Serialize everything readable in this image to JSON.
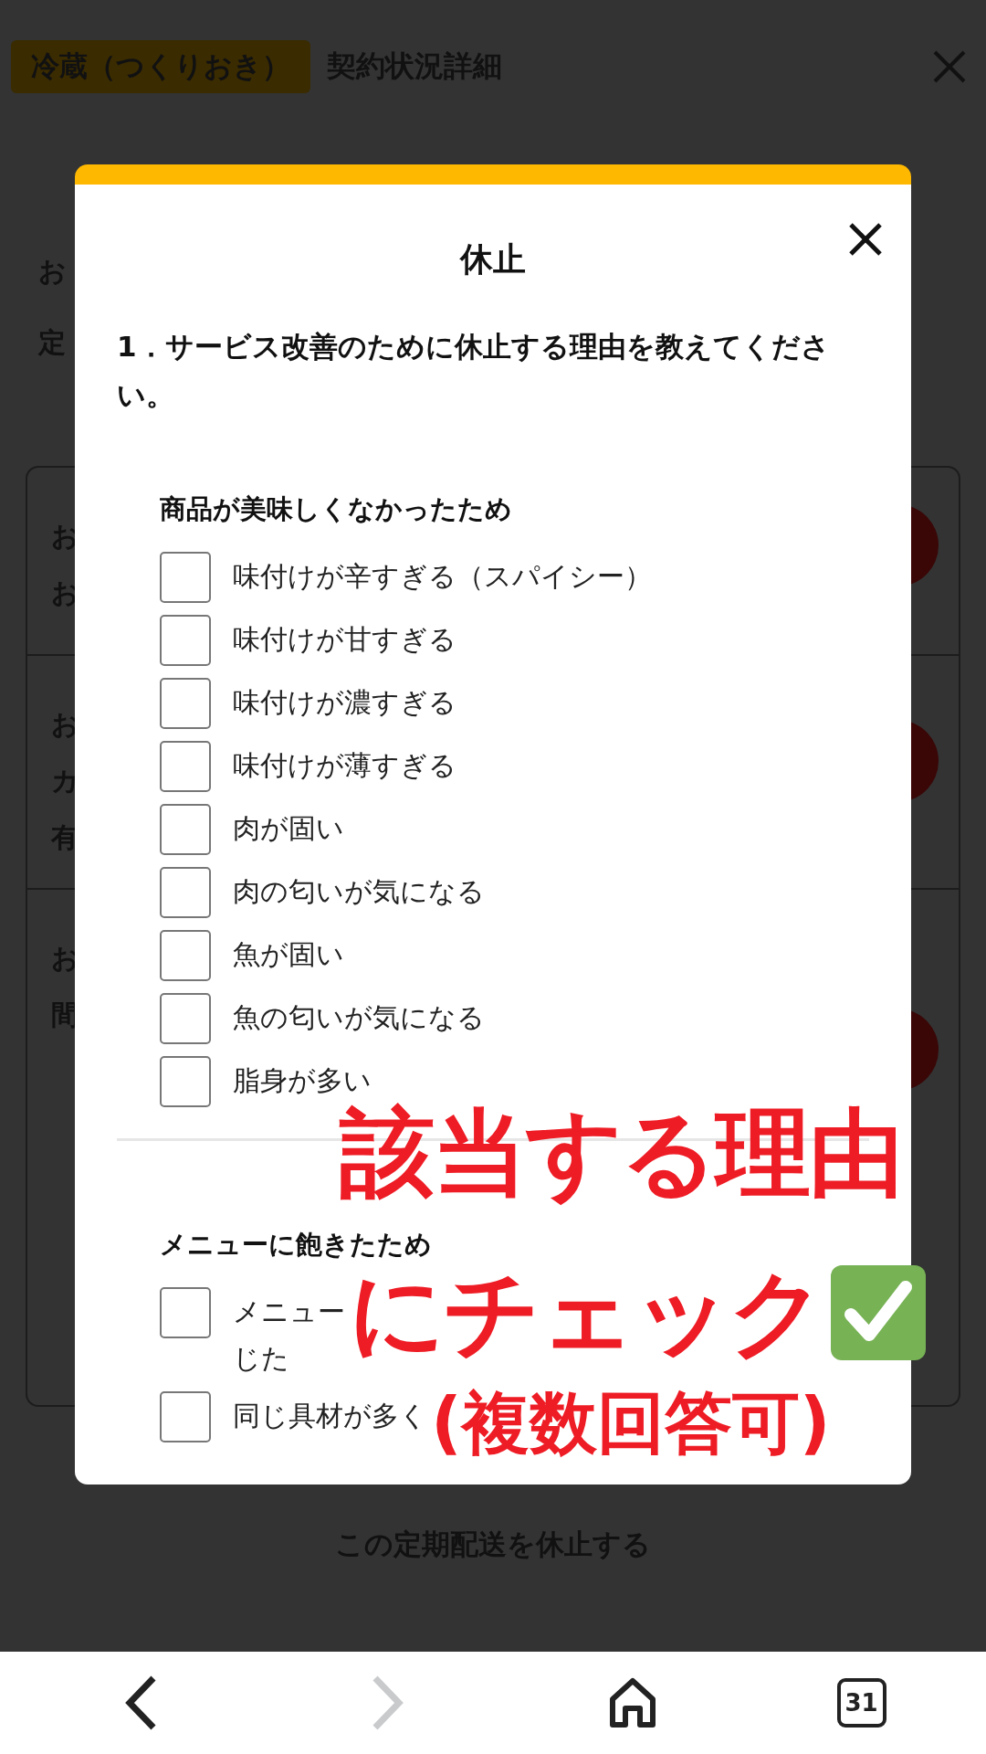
{
  "header": {
    "tag": "冷蔵（つくりおき）",
    "title": "契約状況詳細"
  },
  "page_fragments": [
    "お",
    "定"
  ],
  "card_rows": [
    {
      "lines": [
        "お",
        "お"
      ]
    },
    {
      "lines": [
        "お",
        "カ",
        "有"
      ]
    },
    {
      "lines": [
        "お",
        "間"
      ]
    }
  ],
  "pause_link": "この定期配送を休止する",
  "modal": {
    "title": "休止",
    "question": "1．サービス改善のために休止する理由を教えてください。",
    "sections": [
      {
        "heading": "商品が美味しくなかったため",
        "options": [
          {
            "label": "味付けが辛すぎる（スパイシー）",
            "checked": false
          },
          {
            "label": "味付けが甘すぎる",
            "checked": false
          },
          {
            "label": "味付けが濃すぎる",
            "checked": false
          },
          {
            "label": "味付けが薄すぎる",
            "checked": false
          },
          {
            "label": "肉が固い",
            "checked": false
          },
          {
            "label": "肉の匂いが気になる",
            "checked": false
          },
          {
            "label": "魚が固い",
            "checked": false
          },
          {
            "label": "魚の匂いが気になる",
            "checked": false
          },
          {
            "label": "脂身が多い",
            "checked": false
          }
        ]
      },
      {
        "heading": "メニューに飽きたため",
        "options": [
          {
            "label": "メニュー",
            "label_line2": "じた",
            "checked": false
          },
          {
            "label": "同じ具材が多く",
            "checked": false
          }
        ]
      }
    ]
  },
  "annotation": {
    "lines": [
      "該当する理由",
      "にチェック"
    ],
    "note": "(複数回答可)"
  },
  "browser_nav": {
    "tabs_count": "31",
    "forward_disabled": true
  }
}
